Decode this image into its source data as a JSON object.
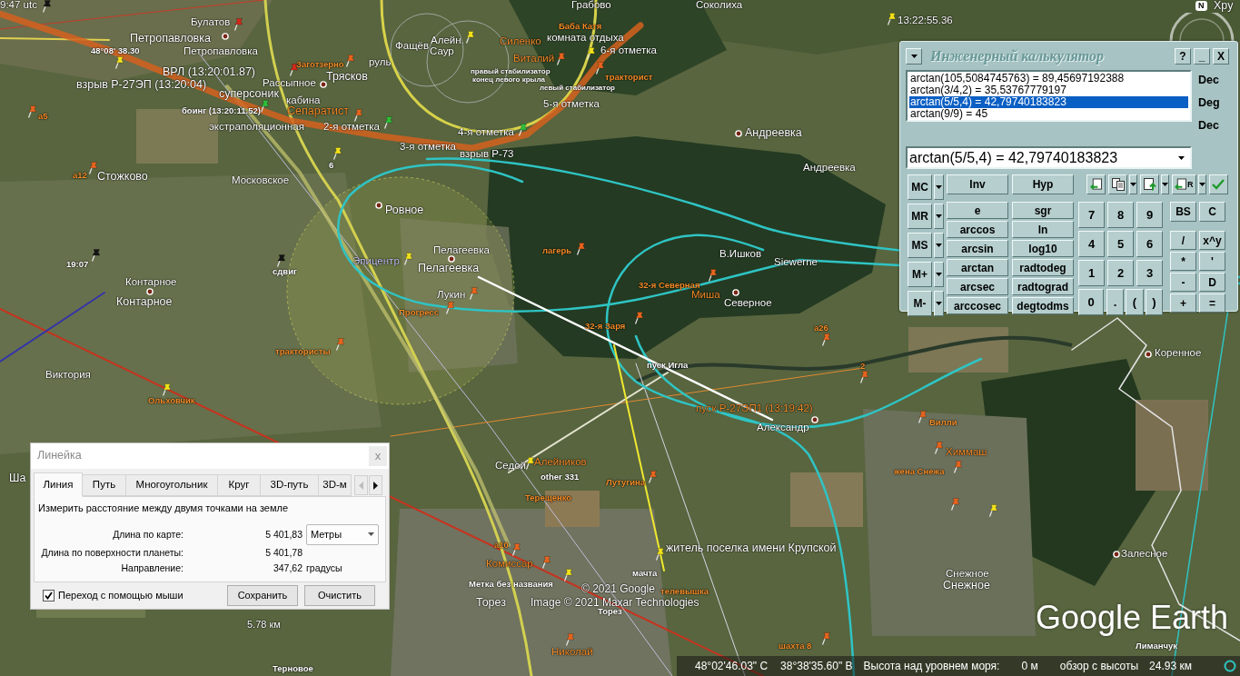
{
  "map": {
    "labels": [
      {
        "text": "9:47 utc",
        "kind": "minor",
        "color": "#ffffff"
      },
      {
        "text": "Грабово",
        "kind": "minor",
        "color": "#ffffff"
      },
      {
        "text": "Соколиха",
        "kind": "minor",
        "color": "#ffffff"
      },
      {
        "text": "Хру",
        "kind": "major",
        "color": "#ffffff"
      },
      {
        "text": "Булатов",
        "kind": "minor",
        "color": "#ffffff"
      },
      {
        "text": "Баба Катя",
        "kind": "tiny",
        "color": "#f28c28"
      },
      {
        "text": "13:22:55.36",
        "kind": "minor",
        "color": "#ffffff"
      },
      {
        "text": "Петропавловка",
        "kind": "major",
        "color": "#ffffff"
      },
      {
        "text": "48°08' 38.30",
        "kind": "tiny",
        "color": "#ffffff"
      },
      {
        "text": "Петропавловка",
        "kind": "minor",
        "color": "#ffffff"
      },
      {
        "text": "Фащёв",
        "kind": "minor",
        "color": "#ffffff"
      },
      {
        "text": "Алейн.",
        "kind": "minor",
        "color": "#ffffff"
      },
      {
        "text": "Силенко",
        "kind": "minor",
        "color": "#f28c28"
      },
      {
        "text": "комната отдыха",
        "kind": "minor",
        "color": "#ffffff"
      },
      {
        "text": "Саур",
        "kind": "minor",
        "color": "#ffffff"
      },
      {
        "text": "ВРЛ (13:20:01.87)",
        "kind": "major",
        "color": "#ffffff"
      },
      {
        "text": "Заготзерно",
        "kind": "tiny",
        "color": "#f28c28"
      },
      {
        "text": "руль",
        "kind": "minor",
        "color": "#ffffff"
      },
      {
        "text": "Виталий",
        "kind": "minor",
        "color": "#f28c28"
      },
      {
        "text": "6-я отметка",
        "kind": "minor",
        "color": "#ffffff"
      },
      {
        "text": "взрыв Р-27ЭП (13:20:04)",
        "kind": "major",
        "color": "#ffffff"
      },
      {
        "text": "Рассыпное",
        "kind": "minor",
        "color": "#ffffff"
      },
      {
        "text": "Трясков",
        "kind": "major",
        "color": "#ffffff"
      },
      {
        "text": "правый стабилизатор",
        "kind": "micro",
        "color": "#ffffff"
      },
      {
        "text": "конец левого крыла",
        "kind": "micro",
        "color": "#ffffff"
      },
      {
        "text": "тракторист",
        "kind": "tiny",
        "color": "#f28c28"
      },
      {
        "text": "суперсоник",
        "kind": "major",
        "color": "#ffffff"
      },
      {
        "text": "левый стабилизатор",
        "kind": "micro",
        "color": "#ffffff"
      },
      {
        "text": "кабина",
        "kind": "minor",
        "color": "#ffffff"
      },
      {
        "text": "а5",
        "kind": "tiny",
        "color": "#f28c28"
      },
      {
        "text": "боинг (13:20:11.52)",
        "kind": "tiny",
        "color": "#ffffff"
      },
      {
        "text": "Сепаратист",
        "kind": "major",
        "color": "#f28c28"
      },
      {
        "text": "5-я отметка",
        "kind": "minor",
        "color": "#ffffff"
      },
      {
        "text": "экстраполяционная",
        "kind": "minor",
        "color": "#ffffff"
      },
      {
        "text": "2-я отметка",
        "kind": "minor",
        "color": "#ffffff"
      },
      {
        "text": "4-я отметка",
        "kind": "minor",
        "color": "#ffffff"
      },
      {
        "text": "Андреевка",
        "kind": "major",
        "color": "#ffffff"
      },
      {
        "text": "3-я отметка",
        "kind": "minor",
        "color": "#ffffff"
      },
      {
        "text": "взрыв Р-73",
        "kind": "minor",
        "color": "#ffffff"
      },
      {
        "text": "6",
        "kind": "tiny",
        "color": "#ffffff"
      },
      {
        "text": "а12",
        "kind": "tiny",
        "color": "#f28c28"
      },
      {
        "text": "Стожково",
        "kind": "major",
        "color": "#ffffff"
      },
      {
        "text": "Андреевка",
        "kind": "minor",
        "color": "#ffffff"
      },
      {
        "text": "Московское",
        "kind": "minor",
        "color": "#ffffff"
      },
      {
        "text": "Ровное",
        "kind": "major",
        "color": "#ffffff"
      },
      {
        "text": "Пелагеевка",
        "kind": "minor",
        "color": "#ffffff"
      },
      {
        "text": "лагерь",
        "kind": "tiny",
        "color": "#f28c28"
      },
      {
        "text": "19:07",
        "kind": "tiny",
        "color": "#ffffff"
      },
      {
        "text": "Эпицентр",
        "kind": "minor",
        "color": "#c4c4f4"
      },
      {
        "text": "В.Ишков",
        "kind": "minor",
        "color": "#ffffff"
      },
      {
        "text": "сдвиг",
        "kind": "tiny",
        "color": "#ffffff"
      },
      {
        "text": "Пелагеевка",
        "kind": "major",
        "color": "#ffffff"
      },
      {
        "text": "Siewerne",
        "kind": "minor",
        "color": "#ffffff"
      },
      {
        "text": "Контарное",
        "kind": "minor",
        "color": "#ffffff"
      },
      {
        "text": "32-я Северная",
        "kind": "tiny",
        "color": "#f28c28"
      },
      {
        "text": "Контарное",
        "kind": "major",
        "color": "#ffffff"
      },
      {
        "text": "Лукин",
        "kind": "minor",
        "color": "#ffffff"
      },
      {
        "text": "Миша",
        "kind": "minor",
        "color": "#f28c28"
      },
      {
        "text": "Северное",
        "kind": "minor",
        "color": "#ffffff"
      },
      {
        "text": "Прогресс",
        "kind": "tiny",
        "color": "#f28c28"
      },
      {
        "text": "32-я Заря",
        "kind": "tiny",
        "color": "#f28c28"
      },
      {
        "text": "а26",
        "kind": "tiny",
        "color": "#f28c28"
      },
      {
        "text": "трактористы",
        "kind": "tiny",
        "color": "#f28c28"
      },
      {
        "text": "Коренное",
        "kind": "minor",
        "color": "#ffffff"
      },
      {
        "text": "пуск Игла",
        "kind": "tiny",
        "color": "#ffffff"
      },
      {
        "text": "2",
        "kind": "tiny",
        "color": "#f28c28"
      },
      {
        "text": "Виктория",
        "kind": "minor",
        "color": "#ffffff"
      },
      {
        "text": "Ольховчик",
        "kind": "tiny",
        "color": "#f28c28"
      },
      {
        "text": "пуск Р-27ЭП1 (13:19:42)",
        "kind": "minor",
        "color": "#f28c28"
      },
      {
        "text": "Александр",
        "kind": "minor",
        "color": "#ffffff"
      },
      {
        "text": "Вилли",
        "kind": "tiny",
        "color": "#f28c28"
      },
      {
        "text": "Химмаш",
        "kind": "minor",
        "color": "#f28c28"
      },
      {
        "text": "Седой",
        "kind": "minor",
        "color": "#ffffff"
      },
      {
        "text": "Алейников",
        "kind": "minor",
        "color": "#f28c28"
      },
      {
        "text": "Ша",
        "kind": "major",
        "color": "#ffffff"
      },
      {
        "text": "other 331",
        "kind": "tiny",
        "color": "#ffffff"
      },
      {
        "text": "жена Снежа",
        "kind": "tiny",
        "color": "#f28c28"
      },
      {
        "text": "Лутугина",
        "kind": "tiny",
        "color": "#f28c28"
      },
      {
        "text": "Терещенко",
        "kind": "tiny",
        "color": "#f28c28"
      },
      {
        "text": "а10",
        "kind": "tiny",
        "color": "#f28c28"
      },
      {
        "text": "житель поселка имени Крупской",
        "kind": "major",
        "color": "#ffffff"
      },
      {
        "text": "Залесное",
        "kind": "minor",
        "color": "#ffffff"
      },
      {
        "text": "Комиссар",
        "kind": "minor",
        "color": "#f28c28"
      },
      {
        "text": "мачта",
        "kind": "tiny",
        "color": "#ffffff"
      },
      {
        "text": "Снежное",
        "kind": "minor",
        "color": "#ffffff"
      },
      {
        "text": "Метка без названия",
        "kind": "tiny",
        "color": "#ffffff"
      },
      {
        "text": "© 2021 Google",
        "kind": "credit",
        "color": "#ffffff"
      },
      {
        "text": "телевышка",
        "kind": "tiny",
        "color": "#f28c28"
      },
      {
        "text": "Снежное",
        "kind": "major",
        "color": "#ffffff"
      },
      {
        "text": "Торез",
        "kind": "major",
        "color": "#ffffff"
      },
      {
        "text": "Image © 2021 Maxar Technologies",
        "kind": "credit",
        "color": "#ffffff"
      },
      {
        "text": "Торез",
        "kind": "tiny",
        "color": "#ffffff"
      },
      {
        "text": "Николай",
        "kind": "minor",
        "color": "#f28c28"
      },
      {
        "text": "шахта 8",
        "kind": "tiny",
        "color": "#f28c28"
      },
      {
        "text": "Лиманчук",
        "kind": "tiny",
        "color": "#ffffff"
      },
      {
        "text": "Терновое",
        "kind": "tiny",
        "color": "#ffffff"
      }
    ],
    "compass": "N",
    "scale": "5.78 км",
    "logo": "Google Earth"
  },
  "calculator": {
    "title": "Инженерный калькулятор",
    "window_buttons": [
      "?",
      "_",
      "X"
    ],
    "history": [
      {
        "text": "arctan(105,5084745763) = 89,45697192388",
        "selected": false
      },
      {
        "text": "arctan(3/4,2) = 35,53767779197",
        "selected": false
      },
      {
        "text": "arctan(5/5,4) = 42,79740183823",
        "selected": true
      },
      {
        "text": "arctan(9/9) = 45",
        "selected": false
      }
    ],
    "modes": [
      "Dec",
      "Deg",
      "Dec"
    ],
    "expression": "arctan(5/5,4) = 42,79740183823",
    "memory": [
      {
        "label": "MC",
        "menu": true
      },
      {
        "label": "MR",
        "menu": true
      },
      {
        "label": "MS",
        "menu": true
      },
      {
        "label": "M+",
        "menu": true
      },
      {
        "label": "M-",
        "menu": true
      }
    ],
    "toggles": [
      "Inv",
      "Hyp"
    ],
    "toolbar": [
      {
        "kind": "import",
        "menu": false
      },
      {
        "kind": "copy",
        "menu": true
      },
      {
        "kind": "export",
        "menu": true
      },
      {
        "kind": "recall",
        "label": "R",
        "menu": true
      },
      {
        "kind": "apply",
        "menu": false
      }
    ],
    "functions": [
      "e",
      "sgr",
      "arccos",
      "ln",
      "arcsin",
      "log10",
      "arctan",
      "radtodeg",
      "arcsec",
      "radtograd",
      "arccosec",
      "degtodms"
    ],
    "digits": [
      "7",
      "8",
      "9",
      "4",
      "5",
      "6",
      "1",
      "2",
      "3",
      "0",
      ".",
      "(",
      ")"
    ],
    "operators": [
      "BS",
      "C",
      "/",
      "x^y",
      "*",
      "'",
      "-",
      "D",
      "+",
      "="
    ]
  },
  "ruler": {
    "title": "Линейка",
    "close": {
      "label": "x",
      "disabled": true
    },
    "tabs": [
      {
        "label": "Линия",
        "selected": true
      },
      {
        "label": "Путь",
        "selected": false
      },
      {
        "label": "Многоугольник",
        "selected": false
      },
      {
        "label": "Круг",
        "selected": false
      },
      {
        "label": "3D-путь",
        "selected": false
      },
      {
        "label": "3D-м",
        "selected": false
      }
    ],
    "tab_scroll": [
      {
        "kind": "left",
        "disabled": true
      },
      {
        "kind": "right",
        "disabled": false
      }
    ],
    "description": "Измерить расстояние между двумя точками на земле",
    "measurements": [
      {
        "label": "Длина по карте:",
        "value": "5 401,83",
        "unit_select": "Метры"
      },
      {
        "label": "Длина по поверхности планеты:",
        "value": "5 401,78"
      },
      {
        "label": "Направление:",
        "value": "347,62",
        "unit": "градусы"
      }
    ],
    "checkbox": {
      "label": "Переход с помощью мыши",
      "checked": true
    },
    "buttons": [
      "Сохранить",
      "Очистить"
    ]
  },
  "status_bar": {
    "latitude": "48°02'46.03\" С",
    "longitude": "38°38'35.60\" В",
    "elevation_label": "Высота над уровнем моря:",
    "elevation": "0 м",
    "eye_altitude_label": "обзор с высоты",
    "eye_altitude": "24.93 км"
  }
}
